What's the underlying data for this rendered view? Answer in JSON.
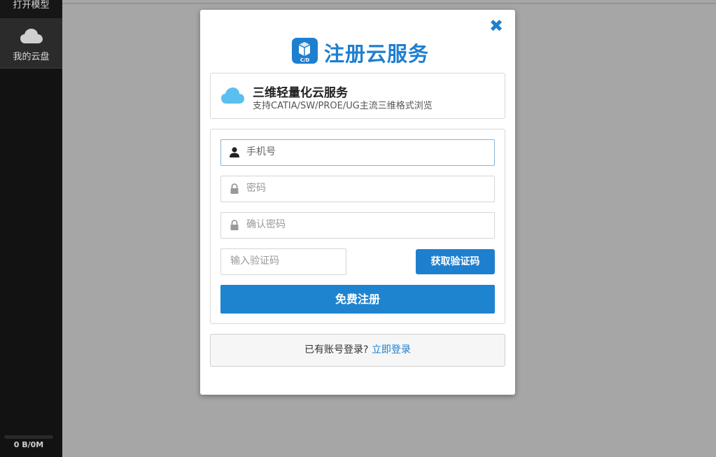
{
  "sidebar": {
    "open_model": "打开模型",
    "my_cloud": "我的云盘",
    "storage": "0 B/0M"
  },
  "modal": {
    "title": "注册云服务",
    "logo_text": "C/D",
    "promo": {
      "title": "三维轻量化云服务",
      "subtitle": "支持CATIA/SW/PROE/UG主流三维格式浏览"
    },
    "form": {
      "phone_placeholder": "手机号",
      "password_placeholder": "密码",
      "confirm_password_placeholder": "确认密码",
      "captcha_placeholder": "输入验证码",
      "get_code_label": "获取验证码",
      "register_label": "免费注册"
    },
    "login": {
      "prompt": "已有账号登录?",
      "link": "立即登录"
    }
  },
  "colors": {
    "accent": "#1f7fcf",
    "sidebar_bg": "#121212",
    "overlay_bg": "#a6a6a6"
  }
}
